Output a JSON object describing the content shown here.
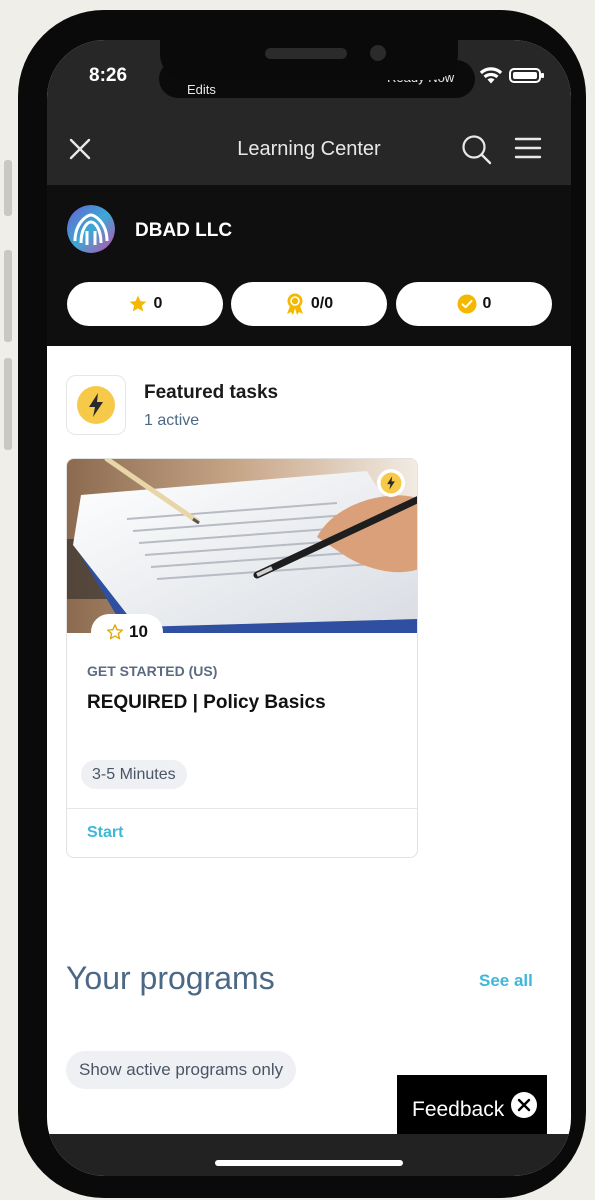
{
  "status_bar": {
    "time": "8:26",
    "pill_left_text": "Edits",
    "pill_right_text": "Ready Now"
  },
  "header": {
    "title": "Learning Center",
    "icons": [
      "close-icon",
      "search-icon",
      "menu-icon"
    ]
  },
  "account": {
    "name": "DBAD LLC",
    "stats": [
      {
        "icon": "star-icon",
        "value": "0",
        "color": "#f5b800"
      },
      {
        "icon": "badge-icon",
        "value": "0/0",
        "color": "#f5b800"
      },
      {
        "icon": "check-circle-icon",
        "value": "0",
        "color": "#f5b800"
      }
    ]
  },
  "featured": {
    "title": "Featured tasks",
    "subtitle": "1 active",
    "icon": "lightning-icon",
    "card": {
      "points": "10",
      "eyebrow": "GET STARTED (US)",
      "title": "REQUIRED | Policy Basics",
      "duration": "3-5 Minutes",
      "action": "Start"
    }
  },
  "programs": {
    "title": "Your programs",
    "see_all": "See all",
    "filter": "Show active programs only"
  },
  "feedback": {
    "label": "Feedback"
  },
  "colors": {
    "accent": "#3fb7d8",
    "gold": "#f5b800",
    "dark_bar": "#272727"
  }
}
